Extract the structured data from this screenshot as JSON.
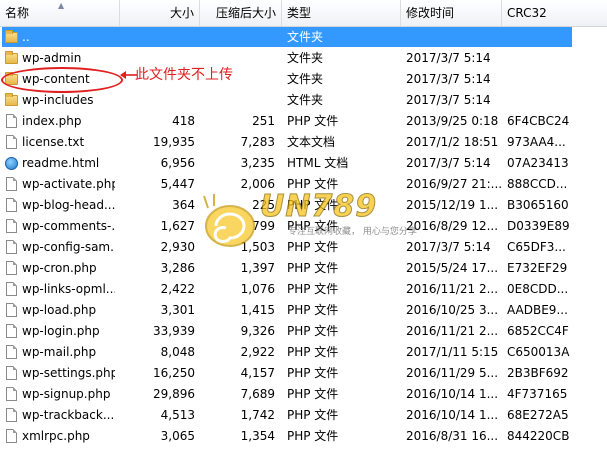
{
  "columns": {
    "name": "名称",
    "size": "大小",
    "packed": "压缩后大小",
    "type": "类型",
    "modified": "修改时间",
    "crc": "CRC32"
  },
  "rows": [
    {
      "name": "..",
      "size": "",
      "packed": "",
      "type": "文件夹",
      "modified": "",
      "crc": "",
      "icon": "folder-icon",
      "selected": true
    },
    {
      "name": "wp-admin",
      "size": "",
      "packed": "",
      "type": "文件夹",
      "modified": "2017/3/7 5:14",
      "crc": "",
      "icon": "folder-icon"
    },
    {
      "name": "wp-content",
      "size": "",
      "packed": "",
      "type": "文件夹",
      "modified": "2017/3/7 5:14",
      "crc": "",
      "icon": "folder-icon"
    },
    {
      "name": "wp-includes",
      "size": "",
      "packed": "",
      "type": "文件夹",
      "modified": "2017/3/7 5:14",
      "crc": "",
      "icon": "folder-icon"
    },
    {
      "name": "index.php",
      "size": "418",
      "packed": "251",
      "type": "PHP 文件",
      "modified": "2013/9/25 0:18",
      "crc": "6F4CBC24",
      "icon": "file-icon"
    },
    {
      "name": "license.txt",
      "size": "19,935",
      "packed": "7,283",
      "type": "文本文档",
      "modified": "2017/1/2 18:51",
      "crc": "973AA4...",
      "icon": "file-icon"
    },
    {
      "name": "readme.html",
      "size": "6,956",
      "packed": "3,235",
      "type": "HTML 文档",
      "modified": "2017/3/7 5:14",
      "crc": "07A23413",
      "icon": "html-icon"
    },
    {
      "name": "wp-activate.php",
      "size": "5,447",
      "packed": "2,006",
      "type": "PHP 文件",
      "modified": "2016/9/27 21:...",
      "crc": "888CCD...",
      "icon": "file-icon"
    },
    {
      "name": "wp-blog-head...",
      "size": "364",
      "packed": "225",
      "type": "PHP 文件",
      "modified": "2015/12/19 1...",
      "crc": "B3065160",
      "icon": "file-icon"
    },
    {
      "name": "wp-comments-...",
      "size": "1,627",
      "packed": "799",
      "type": "PHP 文件",
      "modified": "2016/8/29 12...",
      "crc": "D0339E89",
      "icon": "file-icon"
    },
    {
      "name": "wp-config-sam...",
      "size": "2,930",
      "packed": "1,503",
      "type": "PHP 文件",
      "modified": "2017/3/7 5:14",
      "crc": "C65DF3...",
      "icon": "file-icon"
    },
    {
      "name": "wp-cron.php",
      "size": "3,286",
      "packed": "1,397",
      "type": "PHP 文件",
      "modified": "2015/5/24 17...",
      "crc": "E732EF29",
      "icon": "file-icon"
    },
    {
      "name": "wp-links-opml...",
      "size": "2,422",
      "packed": "1,076",
      "type": "PHP 文件",
      "modified": "2016/11/21 2...",
      "crc": "0E8CDD...",
      "icon": "file-icon"
    },
    {
      "name": "wp-load.php",
      "size": "3,301",
      "packed": "1,415",
      "type": "PHP 文件",
      "modified": "2016/10/25 3...",
      "crc": "AADBE9...",
      "icon": "file-icon"
    },
    {
      "name": "wp-login.php",
      "size": "33,939",
      "packed": "9,326",
      "type": "PHP 文件",
      "modified": "2016/11/21 2...",
      "crc": "6852CC4F",
      "icon": "file-icon"
    },
    {
      "name": "wp-mail.php",
      "size": "8,048",
      "packed": "2,922",
      "type": "PHP 文件",
      "modified": "2017/1/11 5:15",
      "crc": "C650013A",
      "icon": "file-icon"
    },
    {
      "name": "wp-settings.php",
      "size": "16,250",
      "packed": "4,157",
      "type": "PHP 文件",
      "modified": "2016/11/29 5...",
      "crc": "2B3BF692",
      "icon": "file-icon"
    },
    {
      "name": "wp-signup.php",
      "size": "29,896",
      "packed": "7,689",
      "type": "PHP 文件",
      "modified": "2016/10/14 1...",
      "crc": "4F737165",
      "icon": "file-icon"
    },
    {
      "name": "wp-trackback....",
      "size": "4,513",
      "packed": "1,742",
      "type": "PHP 文件",
      "modified": "2016/10/14 1...",
      "crc": "68E272A5",
      "icon": "file-icon"
    },
    {
      "name": "xmlrpc.php",
      "size": "3,065",
      "packed": "1,354",
      "type": "PHP 文件",
      "modified": "2016/8/31 16...",
      "crc": "844220CB",
      "icon": "file-icon"
    }
  ],
  "annotation": {
    "text": "此文件夹不上传",
    "color": "#e02020"
  },
  "watermark": {
    "brand": "UN789",
    "slogan": "专注互联网收藏， 用心与您分享"
  },
  "colors": {
    "selection": "#3399ff",
    "annotation": "#e02020",
    "watermark": "#f7c21a"
  }
}
